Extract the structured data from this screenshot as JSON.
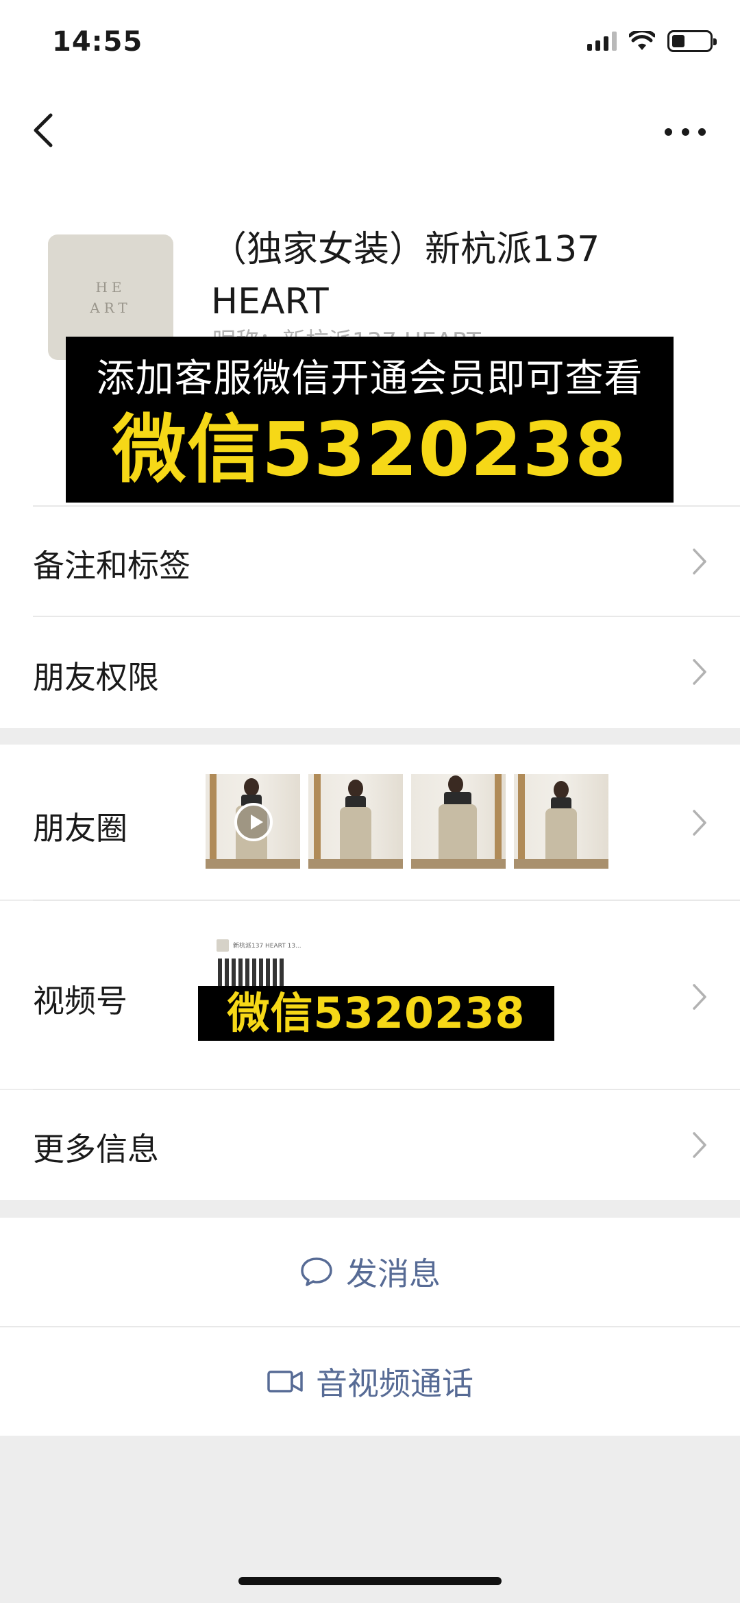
{
  "status_bar": {
    "time": "14:55"
  },
  "profile": {
    "avatar_text_line1": "HE",
    "avatar_text_line2": "ART",
    "name": "（独家女装）新杭派137 HEART",
    "sub": "昵称：新杭派137 HEART"
  },
  "promo": {
    "text": "添加客服微信开通会员即可查看",
    "wechat": "微信5320238"
  },
  "rows": {
    "remarks": "备注和标签",
    "permissions": "朋友权限",
    "moments": "朋友圈",
    "channels": "视频号",
    "more_info": "更多信息"
  },
  "channels_preview": {
    "title": "新杭派137 HEART 13...",
    "overlay": "微信5320238"
  },
  "actions": {
    "send_message": "发消息",
    "video_call": "音视频通话"
  },
  "colors": {
    "link_blue": "#576b95",
    "promo_yellow": "#f6d817"
  }
}
